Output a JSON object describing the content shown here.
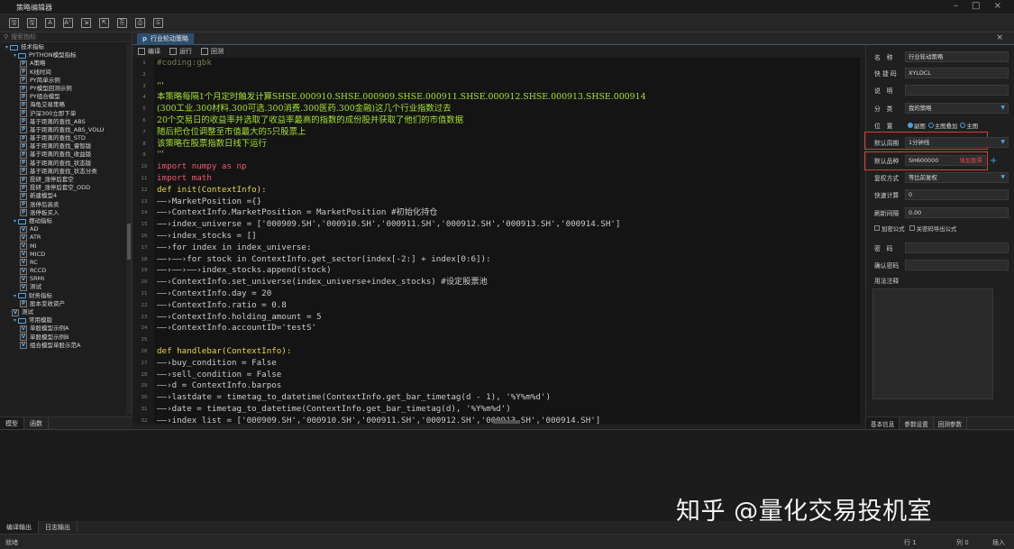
{
  "window": {
    "title": "策略编辑器",
    "controls": "–  □  ×"
  },
  "toolbar": {
    "icons": [
      "save-icon",
      "save-as-icon",
      "font-shrink-icon",
      "font-grow-icon",
      "import-icon",
      "export-icon",
      "copy-icon",
      "paste-icon",
      "print-icon"
    ],
    "glyphs": [
      "🖫",
      "🖫",
      "A",
      "A⁺",
      "⇲",
      "⇱",
      "⎘",
      "⎙",
      "⌸"
    ]
  },
  "left_panel": {
    "search_placeholder": "搜索指标",
    "tree": [
      {
        "level": 0,
        "type": "folder",
        "label": "技术指标"
      },
      {
        "level": 1,
        "type": "folder",
        "label": "PYTHON模型指标"
      },
      {
        "level": 2,
        "type": "p",
        "label": "A策略"
      },
      {
        "level": 2,
        "type": "p",
        "label": "K线时间"
      },
      {
        "level": 2,
        "type": "p",
        "label": "PY简单示例"
      },
      {
        "level": 2,
        "type": "p",
        "label": "PY模型回测示例"
      },
      {
        "level": 2,
        "type": "p",
        "label": "PY组合模型"
      },
      {
        "level": 2,
        "type": "p",
        "label": "海龟交易策略"
      },
      {
        "level": 2,
        "type": "p",
        "label": "沪深300立即下单"
      },
      {
        "level": 2,
        "type": "p",
        "label": "基于距离的查找_ABS"
      },
      {
        "level": 2,
        "type": "p",
        "label": "基于距离的查找_ABS_VOLU"
      },
      {
        "level": 2,
        "type": "p",
        "label": "基于距离的查找_STD"
      },
      {
        "level": 2,
        "type": "p",
        "label": "基于距离的查找_睿智版"
      },
      {
        "level": 2,
        "type": "p",
        "label": "基于距离的查找_收益版"
      },
      {
        "level": 2,
        "type": "p",
        "label": "基于距离的查找_状态版"
      },
      {
        "level": 2,
        "type": "p",
        "label": "基于距离的查找_状态分类"
      },
      {
        "level": 2,
        "type": "p",
        "label": "投研_涨停后套空"
      },
      {
        "level": 2,
        "type": "p",
        "label": "投研_涨停后套空_ODD"
      },
      {
        "level": 2,
        "type": "p",
        "label": "新建模型4"
      },
      {
        "level": 2,
        "type": "p",
        "label": "涨停后高卖"
      },
      {
        "level": 2,
        "type": "p",
        "label": "涨停板买入"
      },
      {
        "level": 1,
        "type": "folder",
        "label": "摆动指标"
      },
      {
        "level": 2,
        "type": "v",
        "label": "AD"
      },
      {
        "level": 2,
        "type": "v",
        "label": "ATR"
      },
      {
        "level": 2,
        "type": "v",
        "label": "MI"
      },
      {
        "level": 2,
        "type": "v",
        "label": "MICD"
      },
      {
        "level": 2,
        "type": "v",
        "label": "RC"
      },
      {
        "level": 2,
        "type": "v",
        "label": "RCCD"
      },
      {
        "level": 2,
        "type": "v",
        "label": "SRMI"
      },
      {
        "level": 2,
        "type": "v",
        "label": "测试"
      },
      {
        "level": 1,
        "type": "folder",
        "label": "财务指标"
      },
      {
        "level": 2,
        "type": "p",
        "label": "股本变收资产"
      },
      {
        "level": 1,
        "type": "v",
        "label": "测试"
      },
      {
        "level": 1,
        "type": "folder",
        "label": "常用模版"
      },
      {
        "level": 2,
        "type": "v",
        "label": "单股模型示例A"
      },
      {
        "level": 2,
        "type": "v",
        "label": "单股模型示例B"
      },
      {
        "level": 2,
        "type": "v",
        "label": "组合模型单股示范A"
      }
    ],
    "tabs": [
      "模型",
      "函数"
    ]
  },
  "doc_tab": {
    "icon": "p",
    "label": "行业轮动策略",
    "close": "×"
  },
  "editor_toolbar": {
    "compile": "编译",
    "run": "运行",
    "backtest": "回测"
  },
  "code": {
    "lines": [
      {
        "t": "#coding:gbk",
        "k": "cm"
      },
      {
        "t": "",
        "k": ""
      },
      {
        "t": "'''",
        "k": "doc"
      },
      {
        "t": "本策略每隔1个月定时触发计算SHSE.000910.SHSE.000909.SHSE.000911.SHSE.000912.SHSE.000913.SHSE.000914",
        "k": "doc"
      },
      {
        "t": "(300工业.300材料.300可选.300消费.300医药.300金融)这几个行业指数过去",
        "k": "doc"
      },
      {
        "t": "20个交易日的收益率并选取了收益率最高的指数的成份股并获取了他们的市值数据",
        "k": "doc"
      },
      {
        "t": "随后把仓位调整至市值最大的5只股票上",
        "k": "doc"
      },
      {
        "t": "该策略在股票指数日线下运行",
        "k": "doc"
      },
      {
        "t": "'''",
        "k": "doc"
      },
      {
        "t": "import numpy as np",
        "k": "kwline"
      },
      {
        "t": "import math",
        "k": "kwline"
      },
      {
        "t": "def init(ContextInfo):",
        "k": "fn"
      },
      {
        "t": "——›MarketPosition ={}",
        "k": ""
      },
      {
        "t": "——›ContextInfo.MarketPosition = MarketPosition #初始化持仓",
        "k": ""
      },
      {
        "t": "——›index_universe = ['000909.SH','000910.SH','000911.SH','000912.SH','000913.SH','000914.SH']",
        "k": ""
      },
      {
        "t": "——›index_stocks = []",
        "k": ""
      },
      {
        "t": "——›for index in index_universe:",
        "k": ""
      },
      {
        "t": "——›——›for stock in ContextInfo.get_sector(index[-2:] + index[0:6]):",
        "k": ""
      },
      {
        "t": "——›——›——›index_stocks.append(stock)",
        "k": ""
      },
      {
        "t": "——›ContextInfo.set_universe(index_universe+index_stocks) #设定股票池",
        "k": ""
      },
      {
        "t": "——›ContextInfo.day = 20",
        "k": ""
      },
      {
        "t": "——›ContextInfo.ratio = 0.8",
        "k": ""
      },
      {
        "t": "——›ContextInfo.holding_amount = 5",
        "k": ""
      },
      {
        "t": "——›ContextInfo.accountID='testS'",
        "k": ""
      },
      {
        "t": "",
        "k": ""
      },
      {
        "t": "def handlebar(ContextInfo):",
        "k": "fn"
      },
      {
        "t": "——›buy_condition = False",
        "k": ""
      },
      {
        "t": "——›sell_condition = False",
        "k": ""
      },
      {
        "t": "——›d = ContextInfo.barpos",
        "k": ""
      },
      {
        "t": "——›lastdate = timetag_to_datetime(ContextInfo.get_bar_timetag(d - 1), '%Y%m%d')",
        "k": ""
      },
      {
        "t": "——›date = timetag_to_datetime(ContextInfo.get_bar_timetag(d), '%Y%m%d')",
        "k": ""
      },
      {
        "t": "——›index_list = ['000909.SH','000910.SH','000911.SH','000912.SH','000913.SH','000914.SH']",
        "k": ""
      }
    ]
  },
  "properties": {
    "name_label": "名　称",
    "name_value": "行业轮动策略",
    "shortcut_label": "快 捷 码",
    "shortcut_value": "XYLDCL",
    "desc_label": "说　明",
    "desc_value": "",
    "category_label": "分　类",
    "category_value": "我的策略",
    "position_label": "位　置",
    "position_options": [
      "副图",
      "主图叠加",
      "主图"
    ],
    "position_selected": 0,
    "period_label": "默认周期",
    "period_value": "1分钟线",
    "symbol_label": "默认品种",
    "symbol_value": "SH600000",
    "symbol_link": "填加股票",
    "adjust_label": "复权方式",
    "adjust_value": "等比前复权",
    "fastcalc_label": "快速计算",
    "fastcalc_value": "0",
    "refresh_label": "刷新间隔",
    "refresh_value": "0.00",
    "encrypt_label": "加密公式",
    "export_label": "关密码导出公式",
    "password_label": "密　码",
    "confirm_label": "确认密码",
    "notes_label": "用法注释",
    "tabs": [
      "基本信息",
      "参数设置",
      "回测参数"
    ]
  },
  "output_tabs": [
    "编译输出",
    "日志输出"
  ],
  "watermark": "知乎 @量化交易投机室",
  "status": {
    "ready": "就绪",
    "row": "行 1",
    "col": "列 0",
    "mode": "插入"
  }
}
